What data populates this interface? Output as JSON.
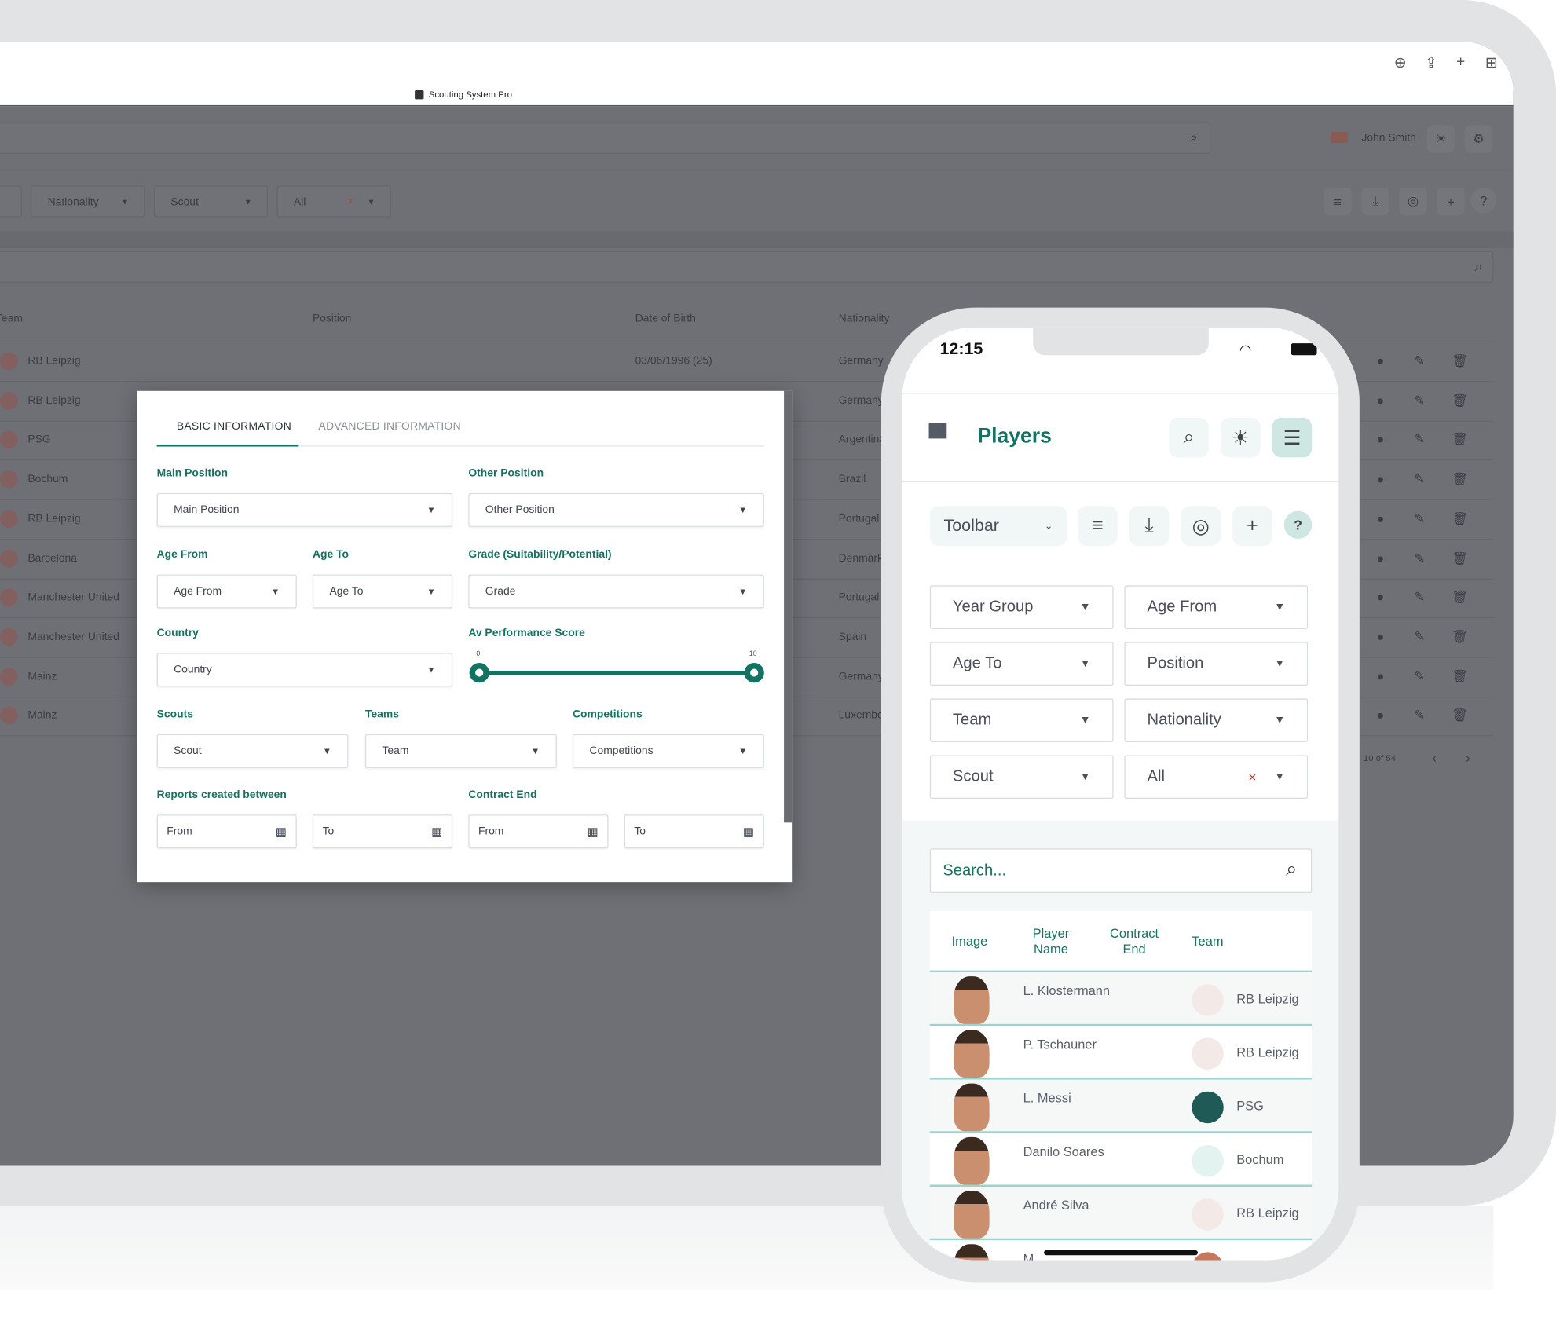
{
  "browser": {
    "title": "Scouting System Pro",
    "icons": [
      "download-circle-icon",
      "share-icon",
      "plus-icon",
      "grid-icon"
    ]
  },
  "desktop": {
    "user": {
      "name": "John Smith",
      "flag": "uk-flag-icon"
    },
    "filters": [
      {
        "label": "Nationality"
      },
      {
        "label": "Scout"
      },
      {
        "label": "All",
        "clear": "×"
      }
    ],
    "table": {
      "headers": {
        "team": "Team",
        "position": "Position",
        "dob": "Date of Birth",
        "nationality": "Nationality"
      },
      "rows": [
        {
          "team": "RB Leipzig",
          "dob": "03/06/1996 (25)",
          "nationality": "Germany"
        },
        {
          "team": "RB Leipzig",
          "nationality": "Germany"
        },
        {
          "team": "PSG",
          "nationality": "Argentina"
        },
        {
          "team": "Bochum",
          "nationality": "Brazil"
        },
        {
          "team": "RB Leipzig",
          "nationality": "Portugal"
        },
        {
          "team": "Barcelona",
          "nationality": "Denmark"
        },
        {
          "team": "Manchester United",
          "nationality": "Portugal"
        },
        {
          "team": "Manchester United",
          "nationality": "Spain"
        },
        {
          "team": "Mainz",
          "nationality": "Germany"
        },
        {
          "team": "Mainz",
          "nationality": "Luxembourg"
        }
      ],
      "pagination": "10 of 54"
    }
  },
  "modal": {
    "tabs": [
      {
        "label": "BASIC INFORMATION",
        "active": true
      },
      {
        "label": "ADVANCED INFORMATION",
        "active": false
      }
    ],
    "main_position": {
      "label": "Main Position",
      "placeholder": "Main Position"
    },
    "other_position": {
      "label": "Other Position",
      "placeholder": "Other Position"
    },
    "age_from": {
      "label": "Age From",
      "placeholder": "Age From"
    },
    "age_to": {
      "label": "Age To",
      "placeholder": "Age To"
    },
    "grade": {
      "label": "Grade (Suitability/Potential)",
      "placeholder": "Grade"
    },
    "country": {
      "label": "Country",
      "placeholder": "Country"
    },
    "performance": {
      "label": "Av Performance Score",
      "min": "0",
      "max": "10",
      "low": 0,
      "high": 10
    },
    "scouts": {
      "label": "Scouts",
      "placeholder": "Scout"
    },
    "teams": {
      "label": "Teams",
      "placeholder": "Team"
    },
    "competitions": {
      "label": "Competitions",
      "placeholder": "Competitions"
    },
    "reports": {
      "label": "Reports created between",
      "from": "From",
      "to": "To"
    },
    "contract": {
      "label": "Contract End",
      "from": "From",
      "to": "To"
    }
  },
  "phone": {
    "time": "12:15",
    "title": "Players",
    "toolbar": "Toolbar",
    "help": "?",
    "filters": [
      "Year Group",
      "Age From",
      "Age To",
      "Position",
      "Team",
      "Nationality",
      "Scout",
      "All"
    ],
    "clear": "×",
    "search_placeholder": "Search...",
    "table": {
      "headers": {
        "image": "Image",
        "name": "Player Name",
        "contract": "Contract End",
        "team": "Team"
      },
      "rows": [
        {
          "name": "L. Klostermann",
          "team": "RB Leipzig"
        },
        {
          "name": "P. Tschauner",
          "team": "RB Leipzig"
        },
        {
          "name": "L. Messi",
          "team": "PSG"
        },
        {
          "name": "Danilo Soares",
          "team": "Bochum"
        },
        {
          "name": "André Silva",
          "team": "RB Leipzig"
        },
        {
          "name": "M",
          "team": ""
        }
      ]
    }
  },
  "colors": {
    "accent": "#137363",
    "overlay": "#6f7075",
    "clear": "#c0392b"
  }
}
